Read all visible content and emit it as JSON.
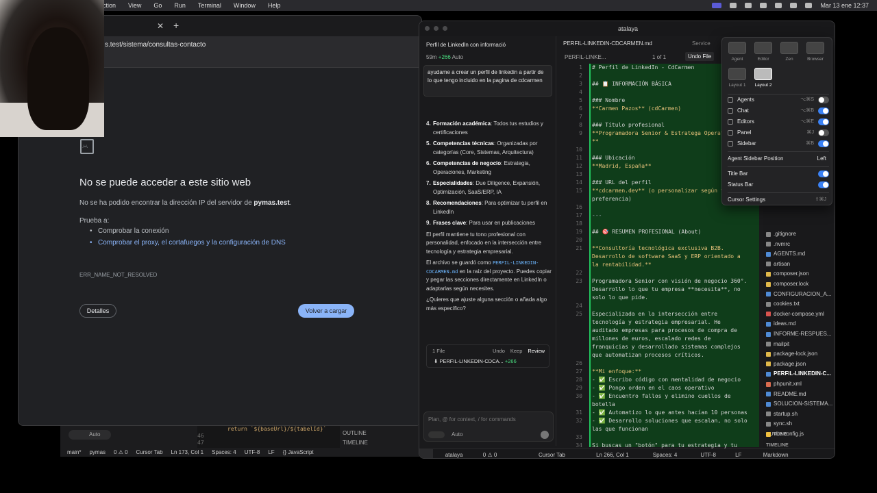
{
  "menubar": {
    "menus": [
      "ction",
      "View",
      "Go",
      "Run",
      "Terminal",
      "Window",
      "Help"
    ],
    "clock": "Mar 13 ene 12:37"
  },
  "browser": {
    "url": "s.test/sistema/consultas-contacto",
    "error_title": "No se puede acceder a este sitio web",
    "error_desc_prefix": "No se ha podido encontrar la dirección IP del servidor de ",
    "error_host": "pymas.test",
    "error_desc_suffix": ".",
    "try_label": "Prueba a:",
    "suggestions": [
      "Comprobar la conexión",
      "Comprobar el proxy, el cortafuegos y la configuración de DNS"
    ],
    "error_code": "ERR_NAME_NOT_RESOLVED",
    "details_button": "Detalles",
    "reload_button": "Volver a cargar"
  },
  "bg_editor": {
    "chip": "Auto",
    "code_line": "return `${baseUrl}/${tabelId}`",
    "line_46": "46",
    "line_47": "47",
    "outline": "OUTLINE",
    "timeline": "TIMELINE",
    "status": [
      "main*",
      "pymas",
      "0 ⚠ 0",
      "Cursor Tab",
      "Ln 173, Col 1",
      "Spaces: 4",
      "UTF-8",
      "LF",
      "{} JavaScript"
    ]
  },
  "cursor": {
    "window_title": "atalaya",
    "chat": {
      "title": "Perfil de LinkedIn con informació",
      "age": "59m",
      "added": "+266",
      "mode": "Auto",
      "user_message": "ayudame a crear un perfil de linkedin a partir de lo que tengo incluido en la pagina de cdcarmen",
      "items": [
        {
          "n": "4.",
          "title": "Formación académica",
          "text": ": Todos tus estudios y certificaciones"
        },
        {
          "n": "5.",
          "title": "Competencias técnicas",
          "text": ": Organizadas por categorías (Core, Sistemas, Arquitectura)"
        },
        {
          "n": "6.",
          "title": "Competencias de negocio",
          "text": ": Estrategia, Operaciones, Marketing"
        },
        {
          "n": "7.",
          "title": "Especialidades",
          "text": ": Due Diligence, Expansión, Optimización, SaaS/ERP, IA"
        },
        {
          "n": "8.",
          "title": "Recomendaciones",
          "text": ": Para optimizar tu perfil en LinkedIn"
        },
        {
          "n": "9.",
          "title": "Frases clave",
          "text": ": Para usar en publicaciones"
        }
      ],
      "para1": "El perfil mantiene tu tono profesional con personalidad, enfocado en la intersección entre tecnología y estrategia empresarial.",
      "para2_prefix": "El archivo se guardó como ",
      "para2_file": "PERFIL-LINKEDIN-CDCARMEN.md",
      "para2_suffix": " en la raíz del proyecto. Puedes copiar y pegar las secciones directamente en LinkedIn o adaptarlas según necesites.",
      "para3": "¿Quieres que ajuste alguna sección o añada algo más específico?",
      "filecard": {
        "count": "1 File",
        "undo": "Undo",
        "keep": "Keep",
        "review": "Review",
        "file": "PERFIL-LINKEDIN-CDCA...",
        "added": "+266"
      },
      "input_placeholder": "Plan, @ for context, / for commands",
      "input_mode": "Auto"
    },
    "editor": {
      "tab": "PERFIL-LINKEDIN-CDCARMEN.md",
      "tab2": "Service",
      "crumb": "PERFIL-LINKE...",
      "page": "1 of 1",
      "undo_file": "Undo File",
      "lines": [
        {
          "n": "1",
          "t": "# Perfil de LinkedIn - CdCarmen",
          "c": "h"
        },
        {
          "n": "2",
          "t": "",
          "c": "h"
        },
        {
          "n": "3",
          "t": "## 📋 INFORMACIÓN BÁSICA",
          "c": "h"
        },
        {
          "n": "4",
          "t": "",
          "c": "h"
        },
        {
          "n": "5",
          "t": "### Nombre",
          "c": "h"
        },
        {
          "n": "6",
          "t": "**Carmen Pazos** (cdCarmen)",
          "c": "bold"
        },
        {
          "n": "7",
          "t": "",
          "c": "h"
        },
        {
          "n": "8",
          "t": "### Título profesional",
          "c": "h"
        },
        {
          "n": "9",
          "t": "**Programadora Senior & Estratega Operat",
          "c": "bold"
        },
        {
          "n": "",
          "t": "**",
          "c": "bold"
        },
        {
          "n": "10",
          "t": "",
          "c": "h"
        },
        {
          "n": "11",
          "t": "### Ubicación",
          "c": "h"
        },
        {
          "n": "12",
          "t": "**Madrid, España**",
          "c": "bold"
        },
        {
          "n": "13",
          "t": "",
          "c": "h"
        },
        {
          "n": "14",
          "t": "### URL del perfil",
          "c": "h"
        },
        {
          "n": "15",
          "t": "**cdcarmen.dev** (o personalizar según t",
          "c": "bold"
        },
        {
          "n": "",
          "t": "preferencia)",
          "c": "h"
        },
        {
          "n": "16",
          "t": "",
          "c": "h"
        },
        {
          "n": "17",
          "t": "---",
          "c": "muted"
        },
        {
          "n": "18",
          "t": "",
          "c": "h"
        },
        {
          "n": "19",
          "t": "## 🎯 RESUMEN PROFESIONAL (About)",
          "c": "h"
        },
        {
          "n": "20",
          "t": "",
          "c": "h"
        },
        {
          "n": "21",
          "t": "**Consultoría tecnológica exclusiva B2B.",
          "c": "bold"
        },
        {
          "n": "",
          "t": "Desarrollo de software SaaS y ERP orientado a",
          "c": "bold"
        },
        {
          "n": "",
          "t": "la rentabilidad.**",
          "c": "bold"
        },
        {
          "n": "22",
          "t": "",
          "c": "h"
        },
        {
          "n": "23",
          "t": "Programadora Senior con visión de negocio 360°.",
          "c": "h"
        },
        {
          "n": "",
          "t": "Desarrollo lo que tu empresa **necesita**, no",
          "c": "h"
        },
        {
          "n": "",
          "t": "solo lo que pide.",
          "c": "h"
        },
        {
          "n": "24",
          "t": "",
          "c": "h"
        },
        {
          "n": "25",
          "t": "Especializada en la intersección entre",
          "c": "h"
        },
        {
          "n": "",
          "t": "tecnología y estrategia empresarial. He",
          "c": "h"
        },
        {
          "n": "",
          "t": "auditado empresas para procesos de compra de",
          "c": "h"
        },
        {
          "n": "",
          "t": "millones de euros, escalado redes de",
          "c": "h"
        },
        {
          "n": "",
          "t": "franquicias y desarrollado sistemas complejos",
          "c": "h"
        },
        {
          "n": "",
          "t": "que automatizan procesos críticos.",
          "c": "h"
        },
        {
          "n": "26",
          "t": "",
          "c": "h"
        },
        {
          "n": "27",
          "t": "**Mi enfoque:**",
          "c": "bold"
        },
        {
          "n": "28",
          "t": "- ✅ Escribo código con mentalidad de negocio",
          "c": "h"
        },
        {
          "n": "29",
          "t": "- ✅ Pongo orden en el caos operativo",
          "c": "h"
        },
        {
          "n": "30",
          "t": "- ✅ Encuentro fallos y elimino cuellos de",
          "c": "h"
        },
        {
          "n": "",
          "t": "botella",
          "c": "h"
        },
        {
          "n": "31",
          "t": "- ✅ Automatizo lo que antes hacían 10 personas",
          "c": "h"
        },
        {
          "n": "32",
          "t": "- ✅ Desarrollo soluciones que escalan, no solo",
          "c": "h"
        },
        {
          "n": "",
          "t": "las que funcionan",
          "c": "h"
        },
        {
          "n": "33",
          "t": "",
          "c": "h"
        },
        {
          "n": "34",
          "t": "Si buscas un \"botón\" para tu estrategia y tu",
          "c": "h"
        }
      ]
    },
    "explorer": {
      "files": [
        {
          "name": ".gitignore",
          "color": "#888"
        },
        {
          "name": ".nvmrc",
          "color": "#888"
        },
        {
          "name": "AGENTS.md",
          "color": "#4f8bd6"
        },
        {
          "name": "artisan",
          "color": "#888"
        },
        {
          "name": "composer.json",
          "color": "#e0b84a"
        },
        {
          "name": "composer.lock",
          "color": "#e0b84a"
        },
        {
          "name": "CONFIGURACION_A...",
          "color": "#4f8bd6"
        },
        {
          "name": "cookies.txt",
          "color": "#888"
        },
        {
          "name": "docker-compose.yml",
          "color": "#d9534f"
        },
        {
          "name": "ideas.md",
          "color": "#4f8bd6"
        },
        {
          "name": "INFORME-RESPUES...",
          "color": "#4f8bd6"
        },
        {
          "name": "mailpit",
          "color": "#888"
        },
        {
          "name": "package-lock.json",
          "color": "#e0b84a"
        },
        {
          "name": "package.json",
          "color": "#e0b84a"
        },
        {
          "name": "PERFIL-LINKEDIN-C...",
          "color": "#4f8bd6",
          "sel": true
        },
        {
          "name": "phpunit.xml",
          "color": "#d96b4f"
        },
        {
          "name": "README.md",
          "color": "#4f8bd6"
        },
        {
          "name": "SOLUCION-SISTEMA...",
          "color": "#4f8bd6"
        },
        {
          "name": "startup.sh",
          "color": "#888"
        },
        {
          "name": "sync.sh",
          "color": "#888"
        },
        {
          "name": "vite.config.js",
          "color": "#f0c040"
        }
      ],
      "outline": "OUTLINE",
      "timeline": "TIMELINE"
    },
    "popover": {
      "layouts": [
        "Agent",
        "Editor",
        "Zen",
        "Browser",
        "Layout 1",
        "Layout 2"
      ],
      "toggles": [
        {
          "label": "Agents",
          "shortcut": "⌥⌘S",
          "on": false
        },
        {
          "label": "Chat",
          "shortcut": "⌥⌘B",
          "on": true
        },
        {
          "label": "Editors",
          "shortcut": "⌥⌘E",
          "on": true
        },
        {
          "label": "Panel",
          "shortcut": "⌘J",
          "on": false
        },
        {
          "label": "Sidebar",
          "shortcut": "⌘B",
          "on": true
        }
      ],
      "sidebar_position_label": "Agent Sidebar Position",
      "sidebar_position_value": "Left",
      "title_bar": "Title Bar",
      "status_bar": "Status Bar",
      "settings": "Cursor Settings",
      "settings_shortcut": "⇧⌘J"
    },
    "status": [
      "atalaya",
      "0 ⚠ 0",
      "Cursor Tab",
      "Ln 266, Col 1",
      "Spaces: 4",
      "UTF-8",
      "LF",
      "Markdown"
    ]
  }
}
